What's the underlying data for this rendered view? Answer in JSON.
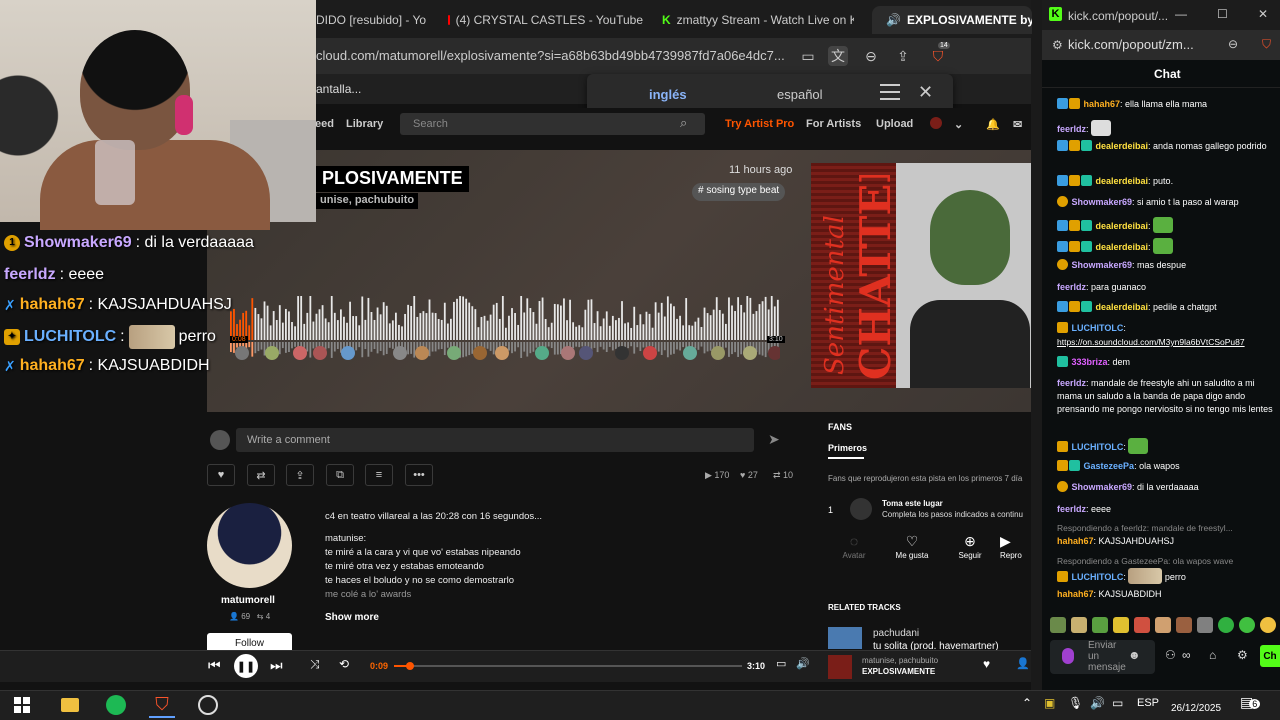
{
  "browser": {
    "tabs": [
      {
        "label": "DIDO [resubido] - Yo"
      },
      {
        "label": "(4) CRYSTAL CASTLES - YouTube"
      },
      {
        "label": "zmattyy Stream - Watch Live on K"
      },
      {
        "label": "EXPLOSIVAMENTE by m"
      }
    ],
    "url": "cloud.com/matumorell/explosivamente?si=a68b63bd49bb4739987fd7a06e4dc7...",
    "bookmark_text": "antalla...",
    "shield_count": "14"
  },
  "translate": {
    "lang_source": "inglés",
    "lang_target": "español"
  },
  "soundcloud": {
    "nav": {
      "feed": "eed",
      "library": "Library",
      "search_placeholder": "Search",
      "try_pro": "Try Artist Pro",
      "for_artists": "For Artists",
      "upload": "Upload"
    },
    "track": {
      "title": "EXPLOSIVAMENTE",
      "title_visible": "PLOSIVAMENTE",
      "artists_visible": "unise, pachubuito",
      "time_ago": "11 hours ago",
      "tag": "# sosing type beat",
      "time_start": "0:08",
      "time_end": "3:10",
      "progress_fraction": 0.04
    },
    "comment_placeholder": "Write a comment",
    "stats": {
      "plays": "170",
      "likes": "27",
      "reposts": "10"
    },
    "user": {
      "name": "matumorell",
      "followers": "69",
      "following": "4",
      "follow_label": "Follow"
    },
    "description": [
      "c4 en teatro villareal a las 20:28 con 16 segundos...",
      "",
      "matunise:",
      "te miré a la cara y vi que vo' estabas nipeando",
      "te miré otra vez y estabas emoteando",
      "te haces el boludo y no se como demostrarlo",
      "me colé a lo' awards"
    ],
    "show_more": "Show more",
    "fans": {
      "title": "FANS",
      "tab": "Primeros",
      "desc": "Fans que reprodujeron esta pista en los primeros 7 día",
      "rank": "1",
      "item_title": "Toma este lugar",
      "item_sub": "Completa los pasos indicados a continu",
      "actions": [
        "Avatar",
        "Me gusta",
        "Seguir",
        "Repro"
      ]
    },
    "related": {
      "title": "RELATED TRACKS",
      "artist": "pachudani",
      "track": "tu solita (prod. havemartner)"
    }
  },
  "player": {
    "time": "0:09",
    "duration": "3:10",
    "progress_fraction": 0.047,
    "artist": "matunise, pachubuito",
    "title": "EXPLOSIVAMENTE"
  },
  "overlay_chat": [
    {
      "badge": "1",
      "name": "Showmaker69",
      "name_color": "#c8a8ff",
      "text": ": di la verdaaaaa"
    },
    {
      "badge": "",
      "name": "feerldz",
      "name_color": "#c8a8ff",
      "text": ": eeee"
    },
    {
      "badge": "sword",
      "name": "hahah67",
      "name_color": "#ffb020",
      "text": ": KAJSJAHDUAHSJ"
    },
    {
      "badge": "gift",
      "name": "LUCHITOLC",
      "name_color": "#6ab0ff",
      "text": "perro",
      "emote": true
    },
    {
      "badge": "sword",
      "name": "hahah67",
      "name_color": "#ffb020",
      "text": ": KAJSUABDIDH"
    }
  ],
  "kick": {
    "window_title": "kick.com/popout/...",
    "url": "kick.com/popout/zm...",
    "chat_title": "Chat",
    "messages": [
      {
        "name": "hahah67",
        "color": "#ffb020",
        "text": ": ella llama ella mama"
      },
      {
        "name": "feerldz",
        "color": "#c8a8ff",
        "text": ":"
      },
      {
        "name": "dealerdeibai",
        "color": "#ffe040",
        "text": ": anda nomas gallego podrido"
      },
      {
        "name": "dealerdeibai",
        "color": "#ffe040",
        "text": ": puto."
      },
      {
        "name": "Showmaker69",
        "color": "#c8a8ff",
        "text": ": si amio t la paso al warap"
      },
      {
        "name": "dealerdeibai",
        "color": "#ffe040",
        "text": ":"
      },
      {
        "name": "dealerdeibai",
        "color": "#ffe040",
        "text": ":"
      },
      {
        "name": "Showmaker69",
        "color": "#c8a8ff",
        "text": ": mas despue"
      },
      {
        "name": "feerldz",
        "color": "#c8a8ff",
        "text": ": para guanaco"
      },
      {
        "name": "dealerdeibai",
        "color": "#ffe040",
        "text": ": pedile a chatgpt"
      },
      {
        "name": "LUCHITOLC",
        "color": "#6ab0ff",
        "text": ":"
      },
      {
        "name": "",
        "color": "#fff",
        "text": "https://on.soundcloud.com/M3yn9la6bVtCSoPu87"
      },
      {
        "name": "333briza",
        "color": "#e060ff",
        "text": ": dem"
      },
      {
        "name": "feerldz",
        "color": "#c8a8ff",
        "text": ": mandale de freestyle ahi un saludito a mi mama un saludo a la banda de papa digo ando prensando me pongo nerviosito si no tengo mis lentes"
      },
      {
        "name": "LUCHITOLC",
        "color": "#6ab0ff",
        "text": ":"
      },
      {
        "name": "GastezeePa",
        "color": "#6ab0ff",
        "text": ": ola wapos"
      },
      {
        "name": "Showmaker69",
        "color": "#c8a8ff",
        "text": ": di la verdaaaaa"
      },
      {
        "name": "feerldz",
        "color": "#c8a8ff",
        "text": ": eeee"
      },
      {
        "name": "hahah67",
        "color": "#ffb020",
        "text": ": KAJSJAHDUAHSJ"
      },
      {
        "name": "LUCHITOLC",
        "color": "#6ab0ff",
        "text": ":"
      },
      {
        "name": "hahah67",
        "color": "#ffb020",
        "text": ": KAJSUABDIDH"
      }
    ],
    "reply1": "Respondiendo a feerldz: mandale de freestyl...",
    "reply2": "Respondiendo a GastezeePa: ola wapos wave",
    "inline_perro": "perro",
    "input_placeholder": "Enviar un mensaje",
    "send_label": "Ch"
  },
  "taskbar": {
    "lang": "ESP",
    "date": "26/12/2025",
    "notifications": "6"
  }
}
